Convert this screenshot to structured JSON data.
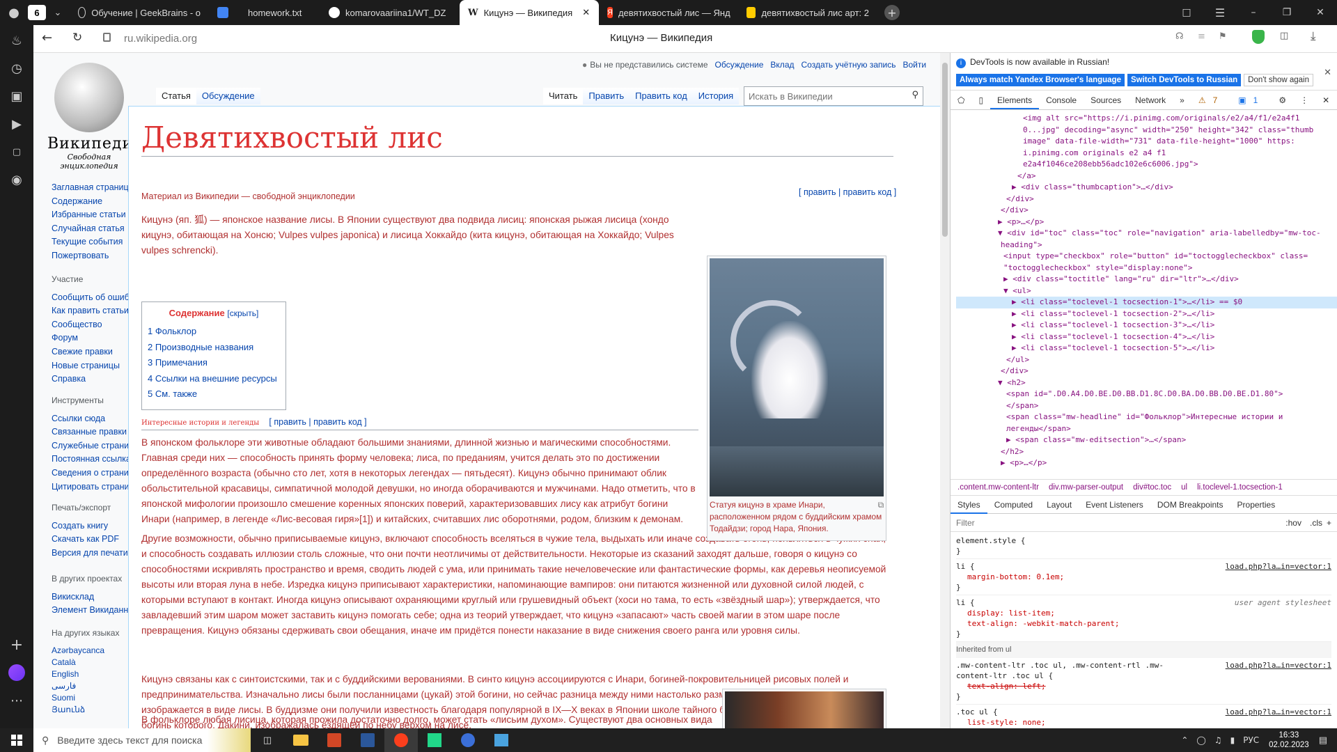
{
  "browser": {
    "tab_count": "6",
    "tabs": [
      {
        "label": "Обучение | GeekBrains - о",
        "color": "#ffffff"
      },
      {
        "label": "homework.txt",
        "color": "#4285f4"
      },
      {
        "label": "komarovaariina1/WT_DZ",
        "color": "#ffffff"
      },
      {
        "label": "Кицунэ — Википедия",
        "color": "#ffffff"
      },
      {
        "label": "девятихвостый лис — Янд",
        "color": "#fc3f1d"
      },
      {
        "label": "девятихвостый лис арт: 2",
        "color": "#ffcc00"
      }
    ],
    "address": "ru.wikipedia.org",
    "page_title": "Кицунэ — Википедия"
  },
  "wiki": {
    "logo_word": "ВикипедиЯ",
    "logo_tagline": "Свободная энциклопедия",
    "user_links": [
      "Вы не представились системе",
      "Обсуждение",
      "Вклад",
      "Создать учётную запись",
      "Войти"
    ],
    "left_tabs": [
      "Статья",
      "Обсуждение"
    ],
    "right_tabs": [
      "Читать",
      "Править",
      "Править код",
      "История"
    ],
    "search_placeholder": "Искать в Википедии",
    "title": "Девятихвостый лис",
    "from_wiki": "Материал из Википедии — свободной энциклопедии",
    "edit_links": "[ править | править код ]",
    "nav_main": [
      "Заглавная страница",
      "Содержание",
      "Избранные статьи",
      "Случайная статья",
      "Текущие события",
      "Пожертвовать"
    ],
    "nav_participation_head": "Участие",
    "nav_participation": [
      "Сообщить об ошибке",
      "Как править статьи",
      "Сообщество",
      "Форум",
      "Свежие правки",
      "Новые страницы",
      "Справка"
    ],
    "nav_tools_head": "Инструменты",
    "nav_tools": [
      "Ссылки сюда",
      "Связанные правки",
      "Служебные страницы",
      "Постоянная ссылка",
      "Сведения о странице",
      "Цитировать страницу"
    ],
    "nav_print_head": "Печать/экспорт",
    "nav_print": [
      "Создать книгу",
      "Скачать как PDF",
      "Версия для печати"
    ],
    "nav_projects_head": "В других проектах",
    "nav_projects": [
      "Викисклад",
      "Элемент Викиданных"
    ],
    "nav_lang_head": "На других языках",
    "nav_lang": [
      "Azərbaycanca",
      "Català",
      "English",
      "فارسی",
      "Suomi",
      "Յաունձ"
    ],
    "toc_title": "Содержание",
    "toc_hide": "[скрыть]",
    "toc": [
      "1  Фольклор",
      "2  Производные названия",
      "3  Примечания",
      "4  Ссылки на внешние ресурсы",
      "5  См. также"
    ],
    "section_heading": "Интересные истории и легенды",
    "section_edit": "[ править | править код ]",
    "image_caption": "Статуя кицунэ в храме Инари, расположенном рядом с буддийским храмом Тодайдзи; город Нара, Япония.",
    "intro": "Кицунэ (яп. 狐) — японское название лисы. В Японии существуют два подвида лисиц: японская рыжая лисица (хондо кицунэ, обитающая на Хонсю; Vulpes vulpes japonica) и лисица Хоккайдо (кита кицунэ, обитающая на Хоккайдо; Vulpes vulpes schrencki).",
    "p1": "В японском фольклоре эти животные обладают большими знаниями, длинной жизнью и магическими способностями. Главная среди них — способность принять форму человека; лиса, по преданиям, учится делать это по достижении определённого возраста (обычно сто лет, хотя в некоторых легендах — пятьдесят). Кицунэ обычно принимают облик обольстительной красавицы, симпатичной молодой девушки, но иногда оборачиваются и мужчинами. Надо отметить, что в японской мифологии произошло смешение коренных японских поверий, характеризовавших лису как атрибут богини Инари (например, в легенде «Лис-весовая гиря»[1]) и китайских, считавших лис оборотнями, родом, близким к демонам.",
    "p2": "Другие возможности, обычно приписываемые кицунэ, включают способность вселяться в чужие тела, выдыхать или иначе создавать огонь, появляться в чужих снах, и способность создавать иллюзии столь сложные, что они почти неотличимы от действительности. Некоторые из сказаний заходят дальше, говоря о кицунэ со способностями искривлять пространство и время, сводить людей с ума, или принимать такие нечеловеческие или фантастические формы, как деревья неописуемой высоты или вторая луна в небе. Изредка кицунэ приписывают характеристики, напоминающие вампиров: они питаются жизненной или духовной силой людей, с которыми вступают в контакт. Иногда кицунэ описывают охраняющими круглый или грушевидный объект (хоси но тама, то есть «звёздный шар»); утверждается, что завладевший этим шаром может заставить кицунэ помогать себе; одна из теорий утверждает, что кицунэ «запасают» часть своей магии в этом шаре после превращения. Кицунэ обязаны сдерживать свои обещания, иначе им придётся понести наказание в виде снижения своего ранга или уровня силы.",
    "p3": "Кицунэ связаны как с синтоистскими, так и с буддийскими верованиями. В синто кицунэ ассоциируются с Инари, богиней-покровительницей рисовых полей и предпринимательства. Изначально лисы были посланницами (цукай) этой богини, но сейчас разница между ними настолько размылась, что Инари сама иногда изображается в виде лисы. В буддизме они получили известность благодаря популярной в IX—X веках в Японии школе тайного буддизма Сингон, одна из главных богинь которого, Дакини, изображалась ездящей по небу верхом на лисе.",
    "p4": "В фольклоре любая лисица, которая прожила достаточно долго, может стать «лисьим духом». Существуют два основных вида кицунэ: мёбу, или божественная лисица, часто ассоциируемая с Инари, и ногицунэ, или дикая лисица (дословно"
  },
  "devtools": {
    "banner": "DevTools is now available in Russian!",
    "btn_match": "Always match Yandex Browser's language",
    "btn_switch": "Switch DevTools to Russian",
    "btn_dont": "Don't show again",
    "tabs": [
      "Elements",
      "Console",
      "Sources",
      "Network"
    ],
    "warn_count": "7",
    "msg_count": "1",
    "dom_lines": [
      "<img alt src=\"https://i.pinimg.com/originals/e2/a4/f1/e2a4f1",
      "0...jpg\" decoding=\"async\" width=\"250\" height=\"342\" class=\"thumb",
      "image\" data-file-width=\"731\" data-file-height=\"1000\" https:",
      "i.pinimg.com originals e2 a4 f1",
      "e2a4f1046ce208ebb56adc102e6c6006.jpg\">",
      "</a>",
      "▶ <div class=\"thumbcaption\">…</div>",
      "</div>",
      "</div>",
      "▶ <p>…</p>",
      "▼ <div id=\"toc\" class=\"toc\" role=\"navigation\" aria-labelledby=\"mw-toc-",
      "heading\">",
      "<input type=\"checkbox\" role=\"button\" id=\"toctogglecheckbox\" class=",
      "\"toctogglecheckbox\" style=\"display:none\">",
      "▶ <div class=\"toctitle\" lang=\"ru\" dir=\"ltr\">…</div>",
      "▼ <ul>",
      "▶ <li class=\"toclevel-1 tocsection-1\">…</li> == $0",
      "▶ <li class=\"toclevel-1 tocsection-2\">…</li>",
      "▶ <li class=\"toclevel-1 tocsection-3\">…</li>",
      "▶ <li class=\"toclevel-1 tocsection-4\">…</li>",
      "▶ <li class=\"toclevel-1 tocsection-5\">…</li>",
      "</ul>",
      "</div>",
      "▼ <h2>",
      "<span id=\".D0.A4.D0.BE.D0.BB.D1.8C.D0.BA.D0.BB.D0.BE.D1.80\">",
      "</span>",
      "<span class=\"mw-headline\" id=\"Фольклор\">Интересные истории и",
      "легенды</span>",
      "▶ <span class=\"mw-editsection\">…</span>",
      "</h2>",
      "▶ <p>…</p>"
    ],
    "breadcrumb": [
      ".content.mw-content-ltr",
      "div.mw-parser-output",
      "div#toc.toc",
      "ul",
      "li.toclevel-1.tocsection-1"
    ],
    "style_tabs": [
      "Styles",
      "Computed",
      "Layout",
      "Event Listeners",
      "DOM Breakpoints",
      "Properties"
    ],
    "filter_placeholder": "Filter",
    "filter_hov": ":hov",
    "filter_cls": ".cls",
    "rules": [
      {
        "sel": "element.style {",
        "src": "",
        "props": []
      },
      {
        "sel": "li {",
        "src": "load.php?la…in=vector:1",
        "props": [
          "margin-bottom: 0.1em;"
        ]
      },
      {
        "sel": "li {",
        "src": "user agent stylesheet",
        "props": [
          "display: list-item;",
          "text-align: -webkit-match-parent;"
        ]
      }
    ],
    "inherited": "Inherited from ul",
    "rule4_sel": ".mw-content-ltr .toc ul, .mw-content-rtl .mw-content-ltr .toc ul {",
    "rule4_src": "load.php?la…in=vector:1",
    "rule4_prop": "text-align: left;",
    "rule5_sel": ".toc ul {",
    "rule5_src": "load.php?la…in=vector:1",
    "rule5_prop": "list-style: none;"
  },
  "taskbar": {
    "search_placeholder": "Введите здесь текст для поиска",
    "lang": "РУС",
    "time": "16:33",
    "date": "02.02.2023"
  }
}
